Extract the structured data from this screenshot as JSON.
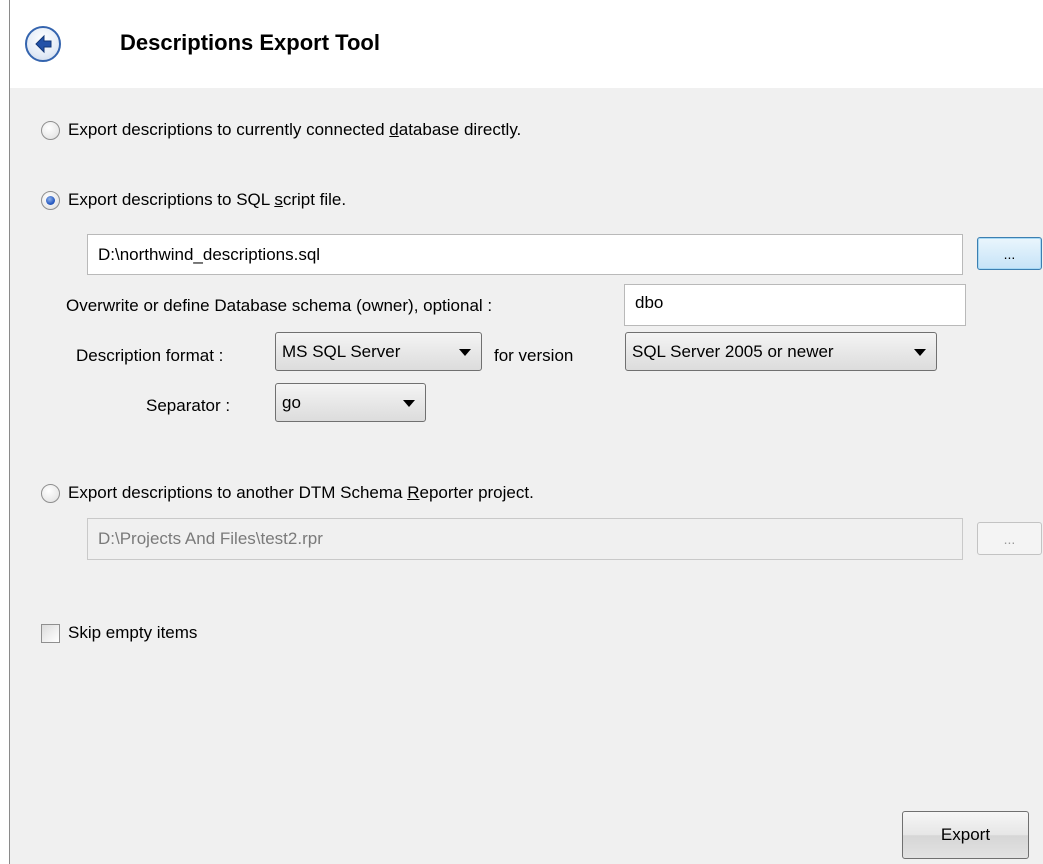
{
  "header": {
    "title": "Descriptions Export Tool"
  },
  "options": {
    "direct": {
      "label_before": "Export descriptions to currently connected ",
      "label_underline": "d",
      "label_after": "atabase directly.",
      "selected": false
    },
    "sql_script": {
      "label_before": "Export descriptions to SQL ",
      "label_underline": "s",
      "label_after": "cript file.",
      "selected": true,
      "file_path": "D:\\northwind_descriptions.sql",
      "browse_label": "...",
      "schema_label": "Overwrite or define Database schema (owner), optional :",
      "schema_value": "dbo",
      "format_label": "Description format :",
      "format_value": "MS SQL Server",
      "version_label": "for version",
      "version_value": "SQL Server 2005 or newer",
      "separator_label": "Separator :",
      "separator_value": "go"
    },
    "project": {
      "label_before": "Export descriptions to another DTM Schema ",
      "label_underline": "R",
      "label_after": "eporter project.",
      "selected": false,
      "file_path": "D:\\Projects And Files\\test2.rpr",
      "browse_label": "..."
    }
  },
  "skip_empty": {
    "label": "Skip empty items",
    "checked": false
  },
  "export_button": {
    "label": "Export"
  },
  "colors": {
    "accent": "#2a5cc4",
    "panel_bg": "#f0f0f0",
    "browse_active_border": "#3c7fb1"
  }
}
